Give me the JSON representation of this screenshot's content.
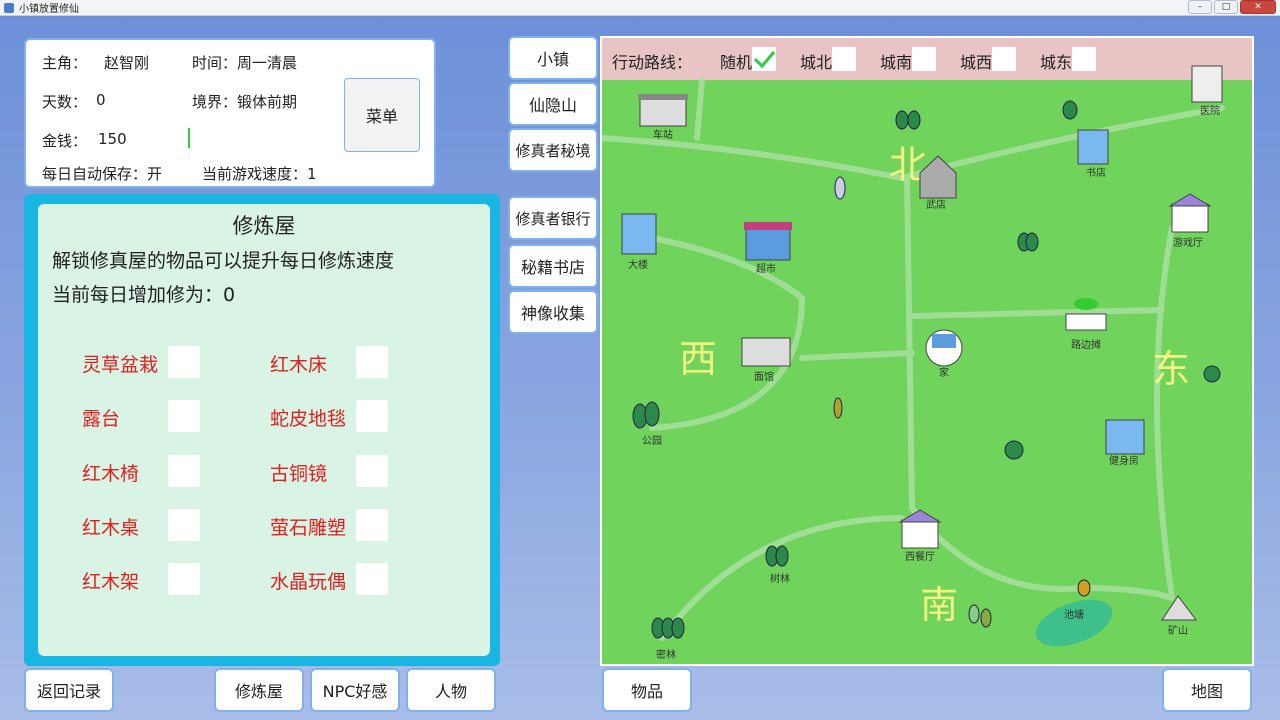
{
  "window": {
    "title": "小镇放置修仙"
  },
  "info": {
    "protagonist_label": "主角：",
    "protagonist_name": "赵智刚",
    "time_label": "时间：周一清晨",
    "days_label": "天数：",
    "days_value": "0",
    "realm_label": "境界：锻体前期",
    "money_label": "金钱：",
    "money_value": "150",
    "autosave": "每日自动保存：开",
    "speed": "当前游戏速度：1",
    "menu_button": "菜单"
  },
  "cultivation": {
    "title": "修炼屋",
    "description": "解锁修真屋的物品可以提升每日修炼速度",
    "bonus": "当前每日增加修为：0",
    "items": [
      "灵草盆栽",
      "红木床",
      "露台",
      "蛇皮地毯",
      "红木椅",
      "古铜镜",
      "红木桌",
      "萤石雕塑",
      "红木架",
      "水晶玩偶"
    ]
  },
  "nav": {
    "town": "小镇",
    "xianyin_mountain": "仙隐山",
    "secret_realm": "修真者秘境",
    "bank": "修真者银行",
    "bookstore": "秘籍书店",
    "statues": "神像收集"
  },
  "bottom": {
    "back_record": "返回记录",
    "cultivation_room": "修炼屋",
    "npc_favor": "NPC好感",
    "character": "人物",
    "items": "物品",
    "map": "地图"
  },
  "route": {
    "label": "行动路线：",
    "options": [
      "随机",
      "城北",
      "城南",
      "城西",
      "城东"
    ],
    "selected": "随机"
  },
  "map": {
    "directions": {
      "north": "北",
      "south": "南",
      "west": "西",
      "east": "东"
    },
    "locations": {
      "station": "车站",
      "hospital": "医院",
      "bookshop": "书店",
      "weapon_shop": "武店",
      "arcade": "游戏厅",
      "building": "大楼",
      "supermarket": "超市",
      "street_stall": "路边摊",
      "noodle_shop": "面馆",
      "home": "家",
      "park": "公园",
      "gym": "健身房",
      "restaurant": "西餐厅",
      "grove": "树林",
      "pond": "池塘",
      "mine": "矿山",
      "dense_forest": "密林"
    }
  },
  "colors": {
    "item_red": "#e02020",
    "map_green": "#6fd35c",
    "panel_border": "#7fb3e8",
    "cult_frame": "#19b6e3",
    "direction_yellow": "#f3f580"
  }
}
